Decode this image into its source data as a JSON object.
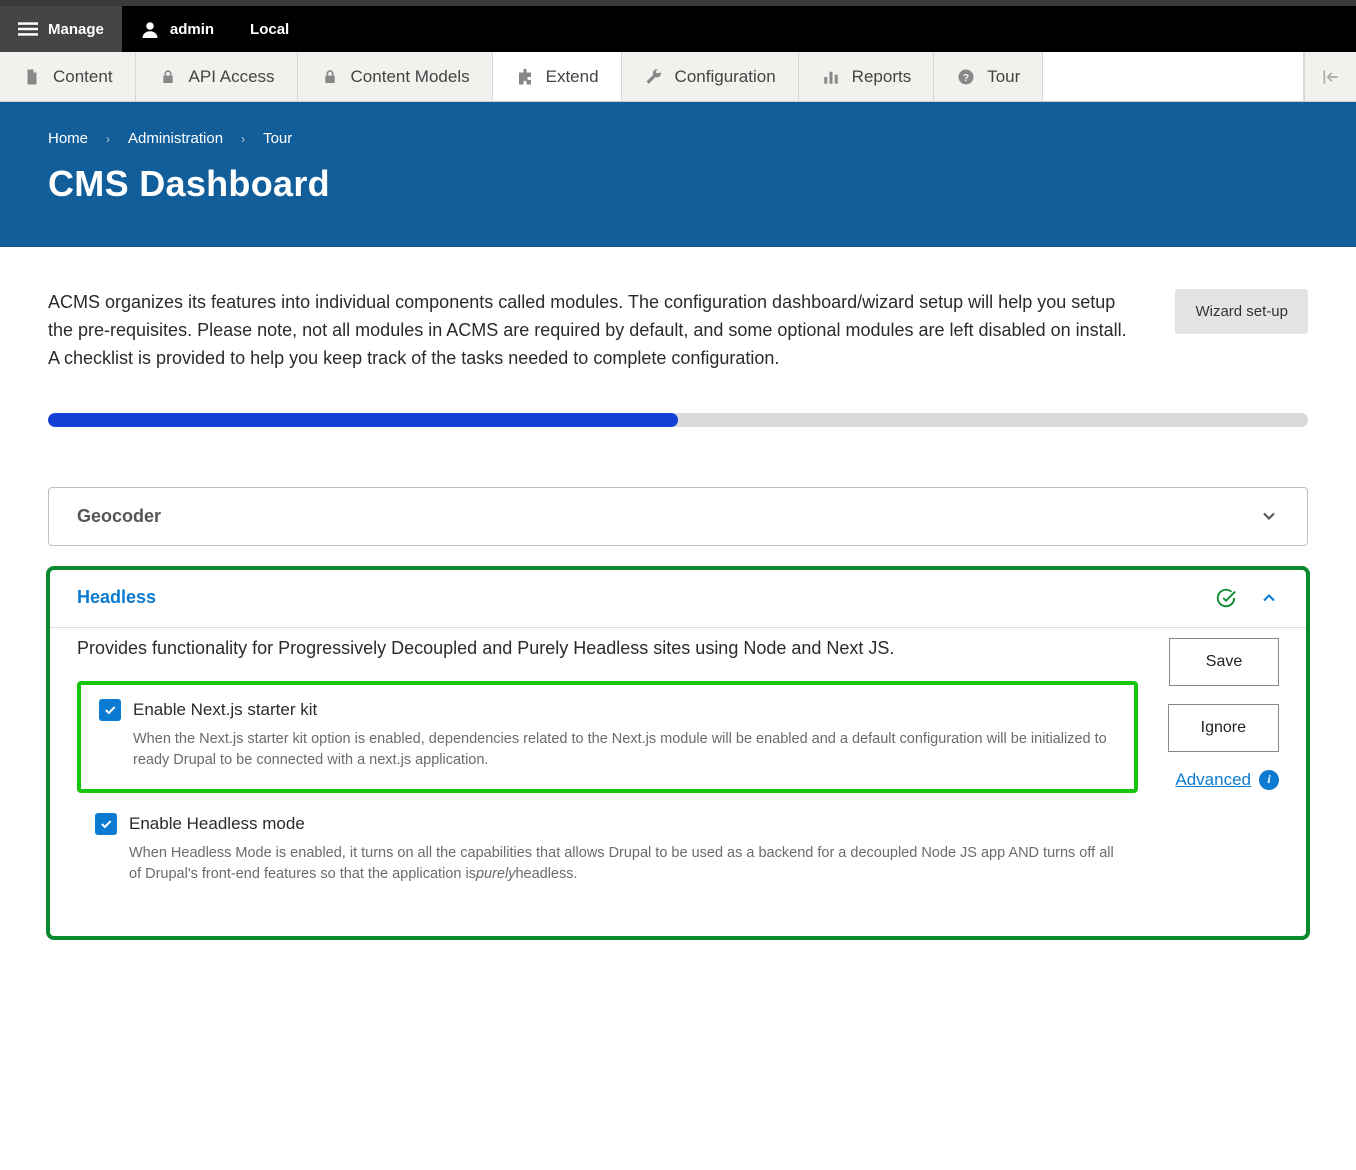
{
  "topbar": {
    "manage": "Manage",
    "user": "admin",
    "env": "Local"
  },
  "tabs": {
    "content": "Content",
    "api": "API Access",
    "models": "Content Models",
    "extend": "Extend",
    "config": "Configuration",
    "reports": "Reports",
    "tour": "Tour"
  },
  "breadcrumb": {
    "home": "Home",
    "admin": "Administration",
    "tour": "Tour"
  },
  "page_title": "CMS Dashboard",
  "intro": "ACMS organizes its features into individual components called modules. The configuration dashboard/wizard setup will help you setup the pre-requisites. Please note, not all modules in ACMS are required by default, and some optional modules are left disabled on install. A checklist is provided to help you keep track of the tasks needed to complete configuration.",
  "wizard_btn": "Wizard set-up",
  "progress_pct": 50,
  "panels": {
    "geocoder": {
      "title": "Geocoder"
    },
    "headless": {
      "title": "Headless",
      "desc": "Provides functionality for Progressively Decoupled and Purely Headless sites using Node and Next JS.",
      "opt1": {
        "label": "Enable Next.js starter kit",
        "sub": "When the Next.js starter kit option is enabled, dependencies related to the Next.js module will be enabled and a default configuration will be initialized to ready Drupal to be connected with a next.js application."
      },
      "opt2": {
        "label": "Enable Headless mode",
        "sub_prefix": "When Headless Mode is enabled, it turns on all the capabilities that allows Drupal to be used as a backend for a decoupled Node JS app AND turns off all of Drupal's front-end features so that the application is",
        "sub_em": "purely",
        "sub_suffix": "headless."
      },
      "save": "Save",
      "ignore": "Ignore",
      "advanced": "Advanced"
    }
  }
}
